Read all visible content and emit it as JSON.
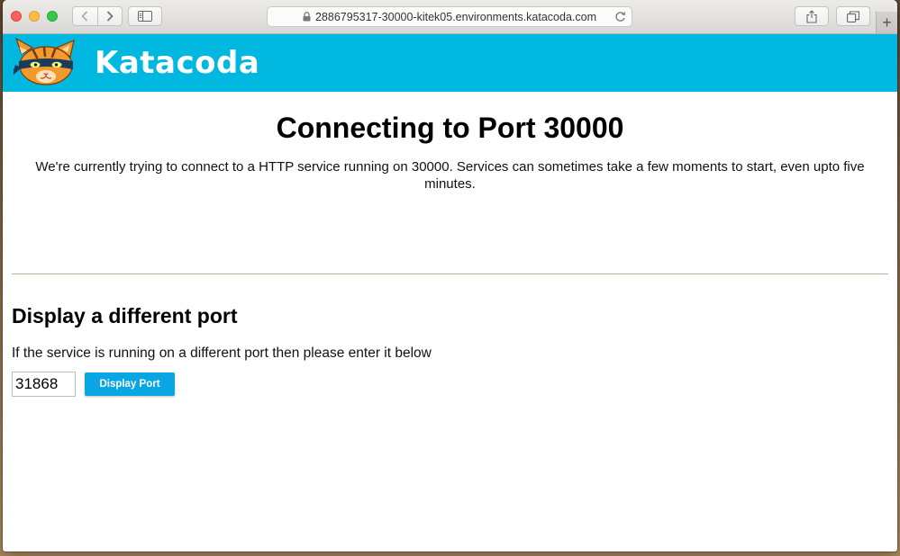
{
  "browser": {
    "url": "2886795317-30000-kitek05.environments.katacoda.com",
    "new_tab_label": "+"
  },
  "brand": {
    "name": "Katacoda",
    "bar_color": "#00b8df"
  },
  "main": {
    "heading": "Connecting to Port 30000",
    "description": "We're currently trying to connect to a HTTP service running on 30000. Services can sometimes take a few moments to start, even upto five minutes."
  },
  "alt_port": {
    "heading": "Display a different port",
    "help": "If the service is running on a different port then please enter it below",
    "input_value": "31868",
    "button_label": "Display Port"
  },
  "colors": {
    "accent": "#0aa6e3",
    "traffic_red": "#fc605b",
    "traffic_yellow": "#fdbc40",
    "traffic_green": "#34c84a"
  },
  "icons": [
    "back-icon",
    "forward-icon",
    "sidebar-icon",
    "lock-icon",
    "reload-icon",
    "share-icon",
    "tabs-icon",
    "katacoda-logo"
  ]
}
